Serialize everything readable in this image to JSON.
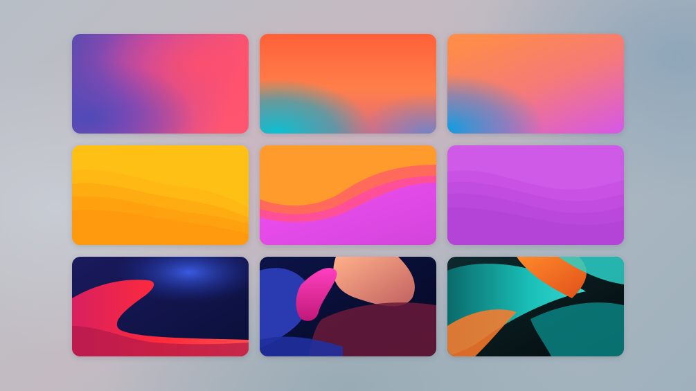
{
  "wallpapers": [
    {
      "name": "gradient-purple-pink",
      "colors": [
        "#5a4bb0",
        "#d246a8",
        "#ff5a6e"
      ]
    },
    {
      "name": "gradient-orange-teal",
      "colors": [
        "#ff6a3a",
        "#ff8a55",
        "#12b6c8"
      ]
    },
    {
      "name": "gradient-orange-magenta",
      "colors": [
        "#ff8a4a",
        "#e25cd0",
        "#1a9fd6"
      ]
    },
    {
      "name": "waves-yellow-orange",
      "colors": [
        "#ffc21a",
        "#ffad14",
        "#ff9a10"
      ]
    },
    {
      "name": "waves-orange-magenta",
      "colors": [
        "#ff9a2a",
        "#ff4f8a",
        "#f240e6"
      ]
    },
    {
      "name": "waves-purple",
      "colors": [
        "#d05ae8",
        "#c44ee0",
        "#b845dc"
      ]
    },
    {
      "name": "abstract-navy-red",
      "colors": [
        "#0c1248",
        "#2a3ab0",
        "#ff2a3c"
      ]
    },
    {
      "name": "abstract-navy-pink",
      "colors": [
        "#0a0f3a",
        "#ff3ab8",
        "#f0a08a"
      ]
    },
    {
      "name": "abstract-teal-orange",
      "colors": [
        "#0a3a3a",
        "#1ac0b8",
        "#ff6a1a"
      ]
    }
  ]
}
